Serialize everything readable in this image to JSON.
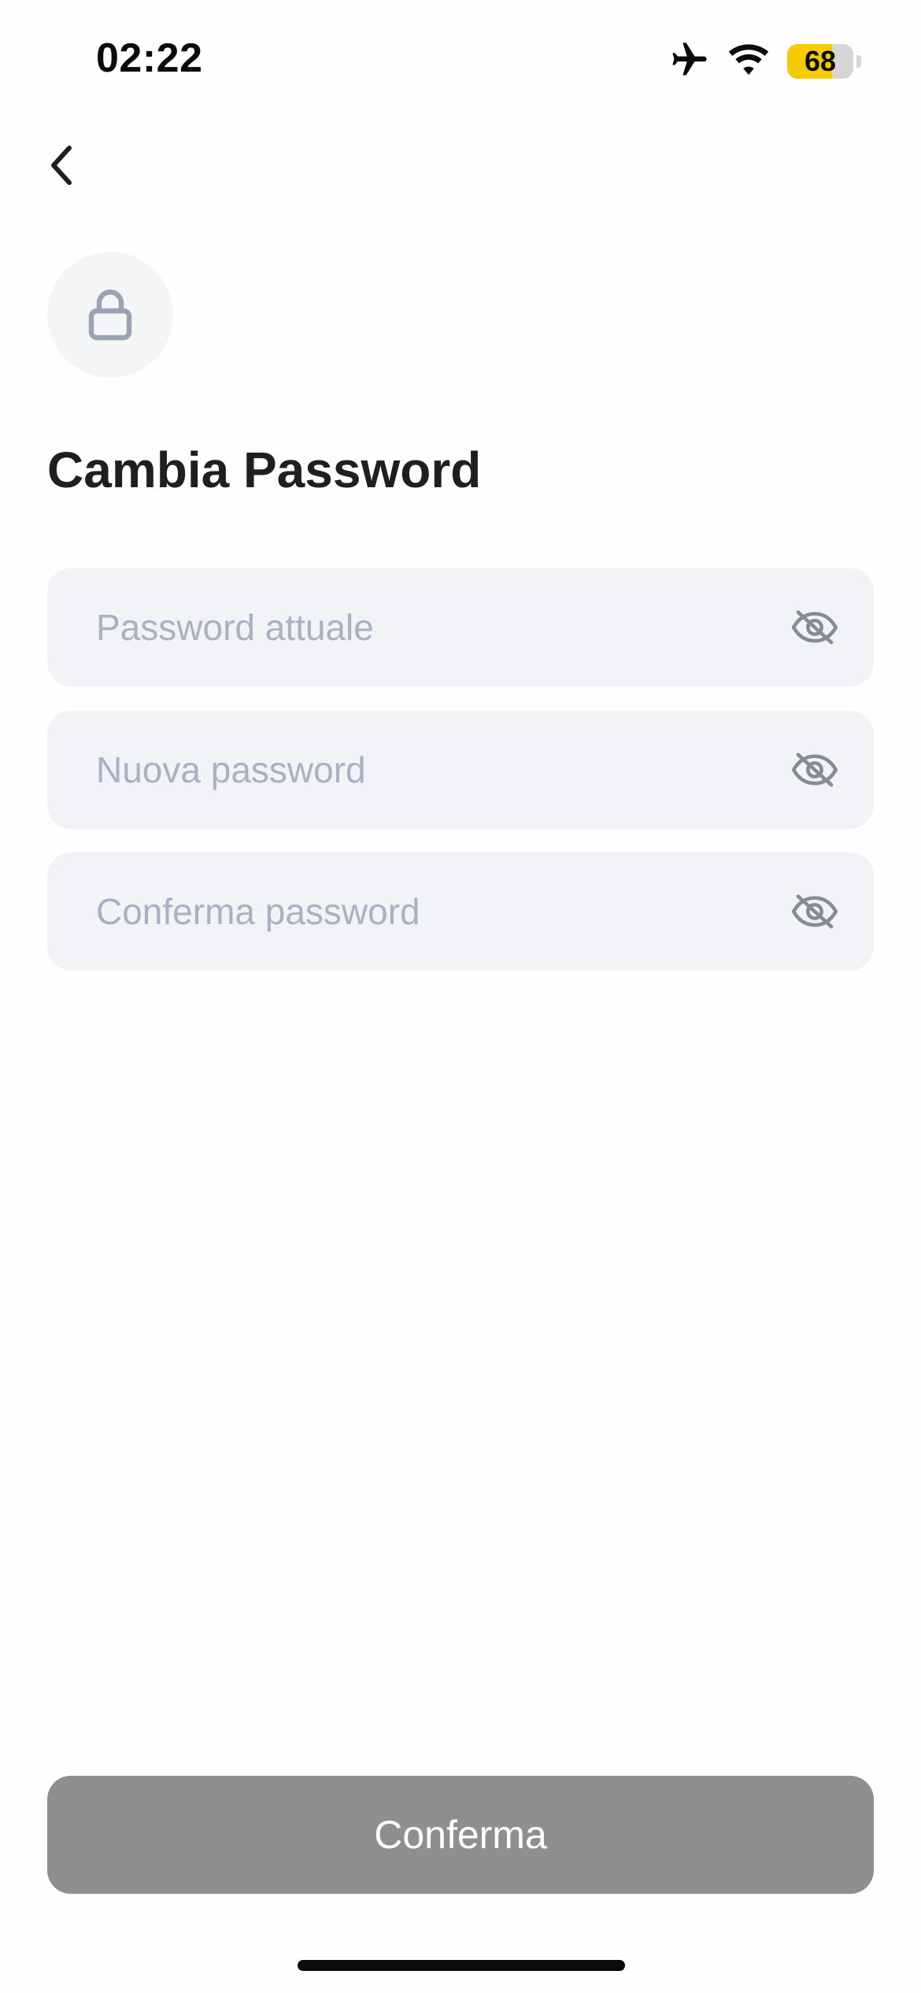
{
  "status_bar": {
    "time": "02:22",
    "battery_level": "68",
    "battery_fraction": 0.68,
    "battery_color": "#f6cc00",
    "icons": [
      "airplane-icon",
      "wifi-icon",
      "battery-icon"
    ]
  },
  "nav": {
    "back_icon": "chevron-left-icon"
  },
  "header": {
    "icon": "lock-icon",
    "title": "Cambia Password"
  },
  "form": {
    "fields": [
      {
        "placeholder": "Password attuale",
        "value": "",
        "toggle_icon": "eye-slash-icon"
      },
      {
        "placeholder": "Nuova password",
        "value": "",
        "toggle_icon": "eye-slash-icon"
      },
      {
        "placeholder": "Conferma password",
        "value": "",
        "toggle_icon": "eye-slash-icon"
      }
    ],
    "submit_label": "Conferma",
    "submit_color": "#8f8f8f"
  }
}
